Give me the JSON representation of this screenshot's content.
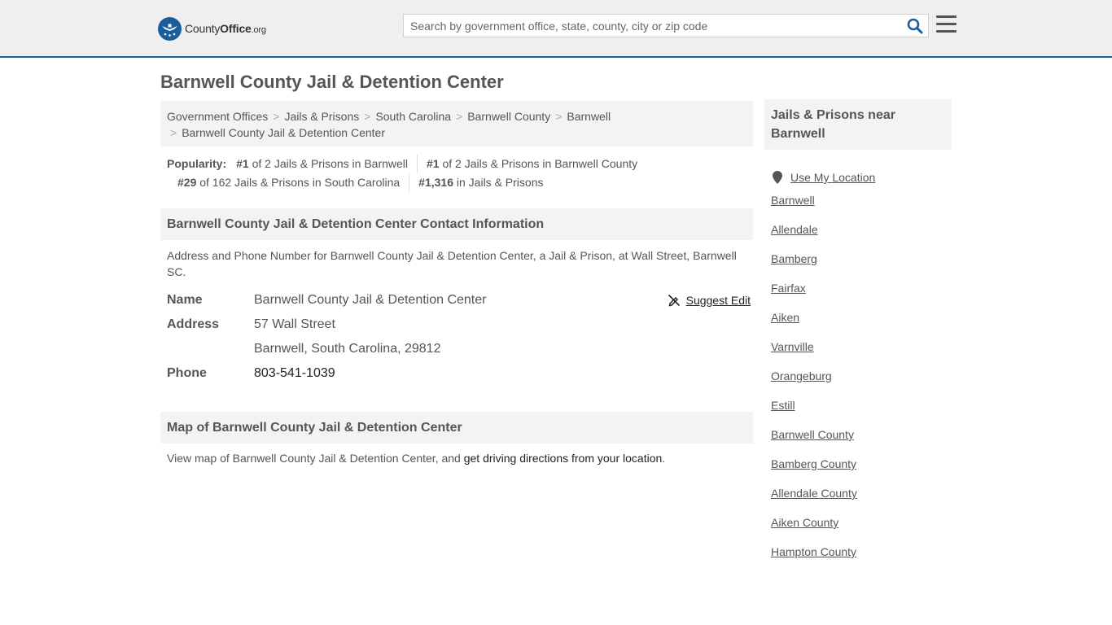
{
  "header": {
    "logo_main": "County",
    "logo_bold": "Office",
    "logo_tld": ".org",
    "search_placeholder": "Search by government office, state, county, city or zip code"
  },
  "page": {
    "title": "Barnwell County Jail & Detention Center"
  },
  "breadcrumb": {
    "items": [
      "Government Offices",
      "Jails & Prisons",
      "South Carolina",
      "Barnwell County",
      "Barnwell"
    ],
    "current": "Barnwell County Jail & Detention Center"
  },
  "popularity": {
    "label": "Popularity:",
    "rank1_num": "#1",
    "rank1_text": " of 2 Jails & Prisons in Barnwell",
    "rank2_num": "#1",
    "rank2_text": " of 2 Jails & Prisons in Barnwell County",
    "rank3_num": "#29",
    "rank3_text": " of 162 Jails & Prisons in South Carolina",
    "rank4_num": "#1,316",
    "rank4_text": " in Jails & Prisons"
  },
  "contact": {
    "heading": "Barnwell County Jail & Detention Center Contact Information",
    "description": "Address and Phone Number for Barnwell County Jail & Detention Center, a Jail & Prison, at Wall Street, Barnwell SC.",
    "name_label": "Name",
    "name_value": "Barnwell County Jail & Detention Center",
    "suggest_edit": "Suggest Edit",
    "address_label": "Address",
    "address_line1": "57 Wall Street",
    "address_line2": "Barnwell, South Carolina, 29812",
    "phone_label": "Phone",
    "phone_value": "803-541-1039"
  },
  "map": {
    "heading": "Map of Barnwell County Jail & Detention Center",
    "text_before": "View map of Barnwell County Jail & Detention Center, and ",
    "link_text": "get driving directions from your location",
    "text_after": "."
  },
  "sidebar": {
    "heading": "Jails & Prisons near Barnwell",
    "use_location": "Use My Location",
    "links": [
      "Barnwell",
      "Allendale",
      "Bamberg",
      "Fairfax",
      "Aiken",
      "Varnville",
      "Orangeburg",
      "Estill",
      "Barnwell County",
      "Bamberg County",
      "Allendale County",
      "Aiken County",
      "Hampton County"
    ]
  },
  "colors": {
    "brand_blue": "#1b5e9c",
    "header_bg": "#efefef",
    "panel_bg": "#f3f3f3"
  }
}
